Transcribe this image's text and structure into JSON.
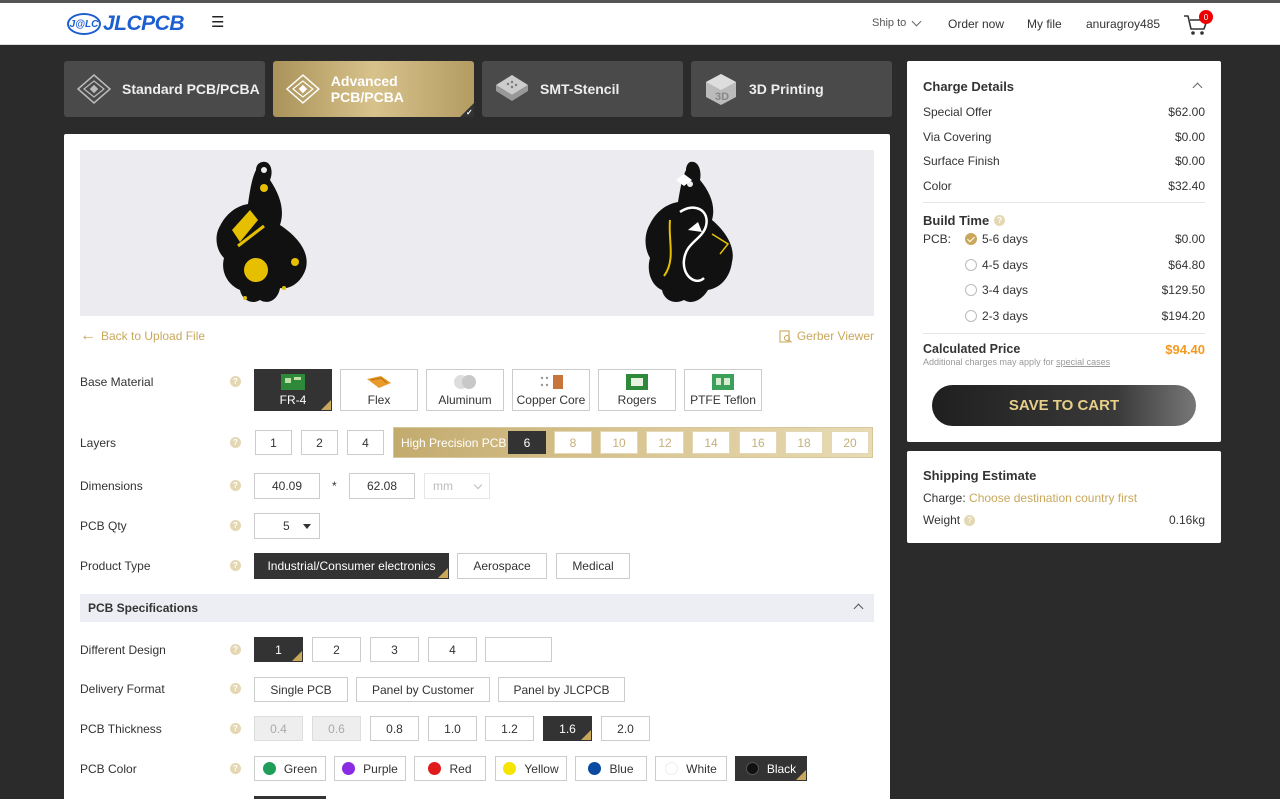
{
  "header": {
    "logo_badge": "J@LC",
    "logo_text": "JLCPCB",
    "ship_to": "Ship to",
    "order_now": "Order now",
    "my_file": "My file",
    "username": "anuragroy485",
    "cart_count": "0"
  },
  "tabs": [
    {
      "label": "Standard PCB/PCBA",
      "active": false
    },
    {
      "label": "Advanced PCB/PCBA",
      "active": true
    },
    {
      "label": "SMT-Stencil",
      "active": false
    },
    {
      "label": "3D Printing",
      "active": false
    }
  ],
  "links": {
    "back": "Back to Upload File",
    "gerber": "Gerber Viewer"
  },
  "labels": {
    "base_material": "Base Material",
    "layers": "Layers",
    "dimensions": "Dimensions",
    "pcb_qty": "PCB Qty",
    "product_type": "Product Type",
    "pcb_specs": "PCB Specifications",
    "different_design": "Different Design",
    "delivery_format": "Delivery Format",
    "pcb_thickness": "PCB Thickness",
    "pcb_color": "PCB Color"
  },
  "base_material": [
    "FR-4",
    "Flex",
    "Aluminum",
    "Copper Core",
    "Rogers",
    "PTFE Teflon"
  ],
  "layers": [
    "1",
    "2",
    "4"
  ],
  "high_precision": {
    "label": "High Precision PCB",
    "options": [
      "6",
      "8",
      "10",
      "12",
      "14",
      "16",
      "18",
      "20"
    ]
  },
  "dimensions": {
    "width": "40.09",
    "times": "*",
    "height": "62.08",
    "unit": "mm"
  },
  "pcb_qty": "5",
  "product_type": [
    "Industrial/Consumer electronics",
    "Aerospace",
    "Medical"
  ],
  "different_design": [
    "1",
    "2",
    "3",
    "4"
  ],
  "delivery_format": [
    "Single PCB",
    "Panel by Customer",
    "Panel by JLCPCB"
  ],
  "pcb_thickness": [
    "0.4",
    "0.6",
    "0.8",
    "1.0",
    "1.2",
    "1.6",
    "2.0"
  ],
  "pcb_color": [
    {
      "name": "Green",
      "hex": "#1f9e5a"
    },
    {
      "name": "Purple",
      "hex": "#8a2be2"
    },
    {
      "name": "Red",
      "hex": "#e01b1b"
    },
    {
      "name": "Yellow",
      "hex": "#f5e400"
    },
    {
      "name": "Blue",
      "hex": "#0a4aa0"
    },
    {
      "name": "White",
      "hex": "#ffffff"
    },
    {
      "name": "Black",
      "hex": "#111111"
    }
  ],
  "charge": {
    "title": "Charge Details",
    "items": [
      {
        "label": "Special Offer",
        "value": "$62.00"
      },
      {
        "label": "Via Covering",
        "value": "$0.00"
      },
      {
        "label": "Surface Finish",
        "value": "$0.00"
      },
      {
        "label": "Color",
        "value": "$32.40"
      }
    ],
    "build_time_title": "Build Time",
    "pcb_label": "PCB:",
    "build_options": [
      {
        "label": "5-6 days",
        "value": "$0.00",
        "selected": true
      },
      {
        "label": "4-5 days",
        "value": "$64.80",
        "selected": false
      },
      {
        "label": "3-4 days",
        "value": "$129.50",
        "selected": false
      },
      {
        "label": "2-3 days",
        "value": "$194.20",
        "selected": false
      }
    ],
    "calculated_label": "Calculated Price",
    "calculated_value": "$94.40",
    "note_prefix": "Additional charges may apply for",
    "note_link": "special cases",
    "save_button": "SAVE TO CART"
  },
  "shipping": {
    "title": "Shipping Estimate",
    "charge_label": "Charge:",
    "charge_value": "Choose destination country first",
    "weight_label": "Weight",
    "weight_value": "0.16kg"
  },
  "colors": {
    "accent_gold": "#c9a85c",
    "price_orange": "#f29a1f",
    "brand_blue": "#1d5fd0",
    "dark_bg": "#2b2b2b"
  }
}
